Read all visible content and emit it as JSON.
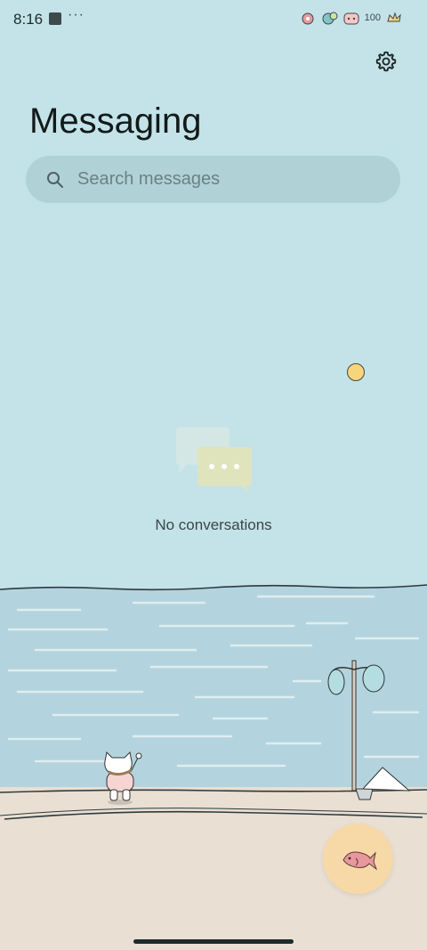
{
  "status_bar": {
    "time": "8:16",
    "more": "···",
    "battery": "100"
  },
  "header": {
    "title": "Messaging"
  },
  "search": {
    "placeholder": "Search messages"
  },
  "empty_state": {
    "text": "No conversations"
  },
  "icons": {
    "settings": "gear-icon",
    "search": "search-icon",
    "compose_fab": "fish-icon"
  },
  "colors": {
    "background": "#c3e3e8",
    "search_bar": "#b0d2d6",
    "sea": "#b3d4de",
    "beach": "#e9dfd3",
    "fab": "#f6d9a7"
  }
}
